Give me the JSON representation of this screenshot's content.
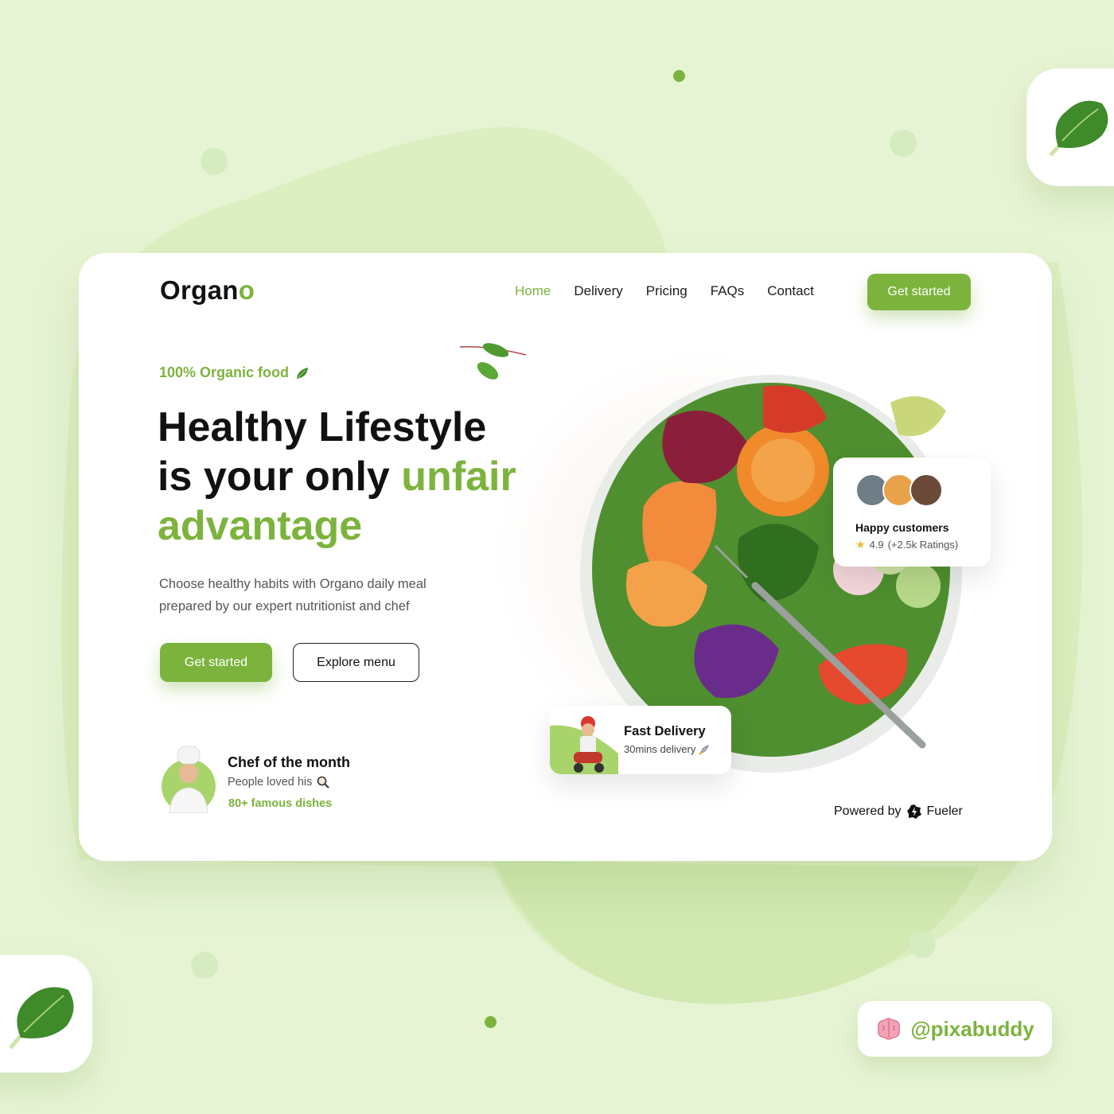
{
  "brand": {
    "logo_main": "Organ",
    "logo_accent": "o"
  },
  "nav": {
    "items": [
      "Home",
      "Delivery",
      "Pricing",
      "FAQs",
      "Contact"
    ],
    "active": "Home",
    "cta_label": "Get started"
  },
  "hero": {
    "tagline": "100% Organic food",
    "headline_line1": "Healthy Lifestyle",
    "headline_line2_plain": "is your only ",
    "headline_line2_accent": "unfair",
    "headline_line3_accent": "advantage",
    "description": "Choose healthy habits with Organo daily meal prepared by our expert nutritionist and chef",
    "primary_button": "Get started",
    "secondary_button": "Explore menu"
  },
  "chef": {
    "title": "Chef of the month",
    "subtitle": "People loved his",
    "dishes": "80+ famous dishes"
  },
  "happy_customers": {
    "title": "Happy customers",
    "rating": "4.9",
    "ratings_count": "(+2.5k Ratings)"
  },
  "delivery": {
    "title": "Fast Delivery",
    "subtitle": "30mins delivery"
  },
  "footer": {
    "powered_by_label": "Powered by",
    "powered_by_brand": "Fueler"
  },
  "watermark": {
    "handle": "@pixabuddy"
  },
  "colors": {
    "accent": "#7cb33d",
    "background": "#e6f4d4",
    "text": "#111111",
    "star": "#f6b72f"
  },
  "icons": [
    "leaf-icon",
    "search-icon",
    "rocket-icon",
    "star-icon",
    "fueler-logo-icon",
    "brain-icon",
    "lettuce-icon"
  ]
}
